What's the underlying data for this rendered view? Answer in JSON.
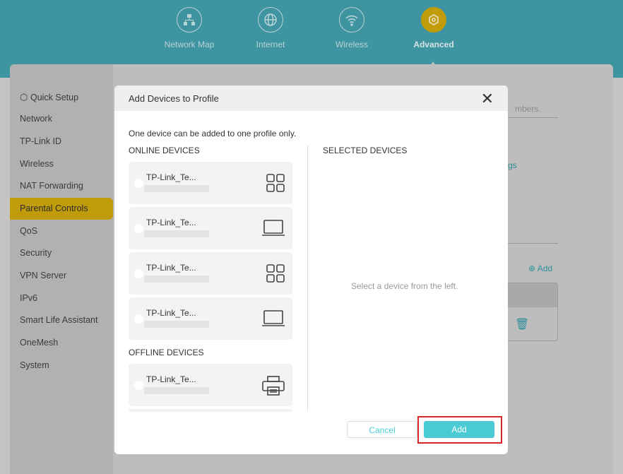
{
  "top_nav": [
    {
      "label": "Network Map",
      "icon": "network-map-icon"
    },
    {
      "label": "Internet",
      "icon": "globe-icon"
    },
    {
      "label": "Wireless",
      "icon": "wifi-icon"
    },
    {
      "label": "Advanced",
      "icon": "gear-icon",
      "active": true
    }
  ],
  "sidebar": {
    "items": [
      {
        "label": "Quick Setup"
      },
      {
        "label": "Network"
      },
      {
        "label": "TP-Link ID"
      },
      {
        "label": "Wireless"
      },
      {
        "label": "NAT Forwarding"
      },
      {
        "label": "Parental Controls",
        "active": true
      },
      {
        "label": "QoS"
      },
      {
        "label": "Security"
      },
      {
        "label": "VPN Server"
      },
      {
        "label": "IPv6"
      },
      {
        "label": "Smart Life Assistant"
      },
      {
        "label": "OneMesh"
      },
      {
        "label": "System"
      }
    ]
  },
  "background": {
    "placeholder_fragment": "mbers.",
    "link_fragment": "gs",
    "add_label": "Add"
  },
  "dialog": {
    "title": "Add Devices to Profile",
    "note": "One device can be added to one profile only.",
    "online_header": "ONLINE DEVICES",
    "selected_header": "SELECTED DEVICES",
    "offline_header": "OFFLINE DEVICES",
    "empty_text": "Select a device from the left.",
    "online_devices": [
      {
        "name": "TP-Link_Te...",
        "icon": "grid-icon"
      },
      {
        "name": "TP-Link_Te...",
        "icon": "laptop-icon"
      },
      {
        "name": "TP-Link_Te...",
        "icon": "grid-icon"
      },
      {
        "name": "TP-Link_Te...",
        "icon": "laptop-icon"
      }
    ],
    "offline_devices": [
      {
        "name": "TP-Link_Te...",
        "icon": "printer-icon"
      }
    ],
    "cancel_label": "Cancel",
    "add_label": "Add"
  },
  "colors": {
    "accent": "#4acbd6",
    "active": "#c19c0a",
    "highlight": "#d9262b"
  }
}
